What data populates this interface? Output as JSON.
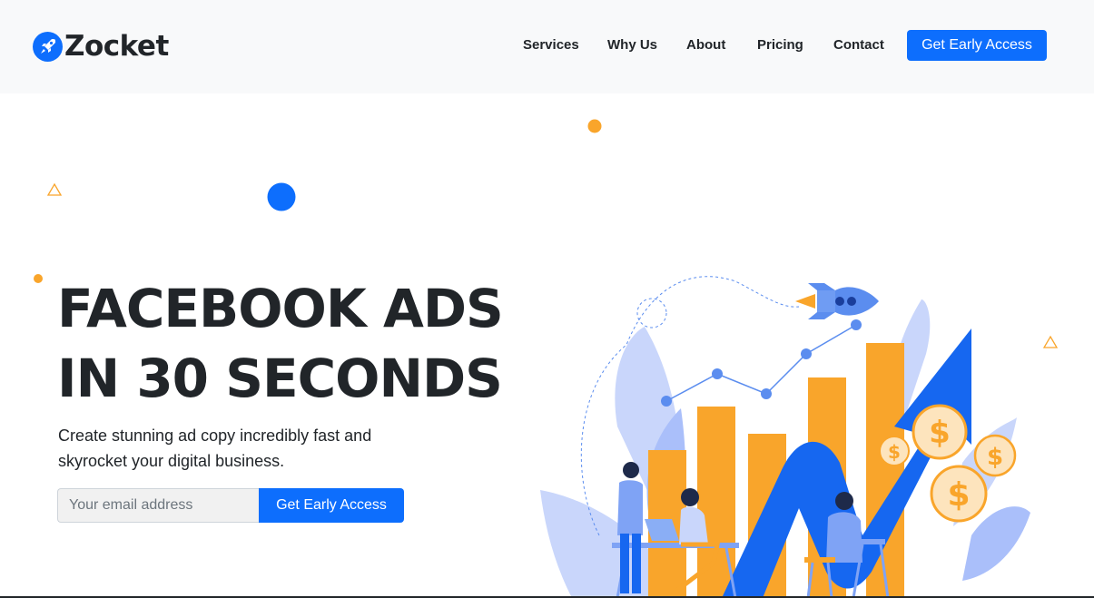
{
  "brand": {
    "name": "Zocket",
    "logo_icon": "rocket-icon",
    "color": "#0d6efd"
  },
  "nav": {
    "items": [
      {
        "label": "Services"
      },
      {
        "label": "Why Us"
      },
      {
        "label": "About"
      },
      {
        "label": "Pricing"
      },
      {
        "label": "Contact"
      }
    ],
    "cta_label": "Get Early Access"
  },
  "hero": {
    "headline_line1": "FACEBOOK ADS",
    "headline_line2": "IN 30 SECONDS",
    "subtext": "Create stunning ad copy incredibly fast and skyrocket your digital business.",
    "email_placeholder": "Your email address",
    "cta_label": "Get Early Access"
  },
  "colors": {
    "primary": "#0d6efd",
    "accent_orange": "#f9a52b",
    "light_blue": "#c9d6fb",
    "dark_text": "#212529"
  }
}
